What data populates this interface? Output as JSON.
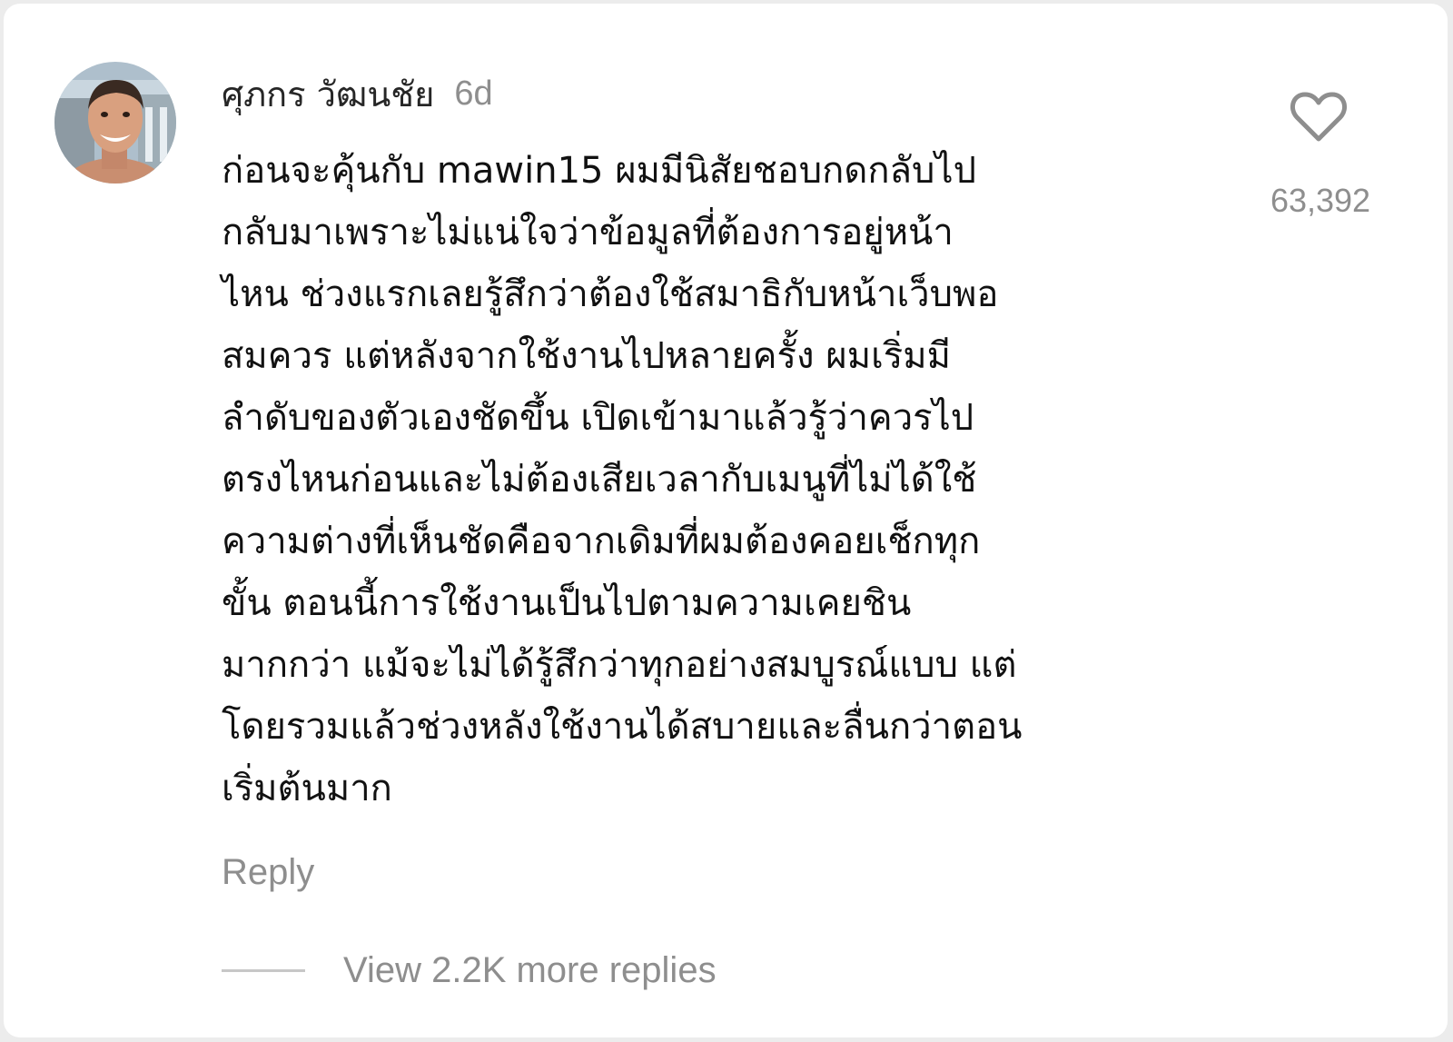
{
  "comment": {
    "author": "ศุภกร วัฒนชัย",
    "timestamp": "6d",
    "lines": [
      "ก่อนจะคุ้นกับ mawin15 ผมมีนิสัยชอบกดกลับไป",
      "กลับมาเพราะไม่แน่ใจว่าข้อมูลที่ต้องการอยู่หน้า",
      "ไหน ช่วงแรกเลยรู้สึกว่าต้องใช้สมาธิกับหน้าเว็บพอ",
      "สมควร แต่หลังจากใช้งานไปหลายครั้ง ผมเริ่มมี",
      "ลำดับของตัวเองชัดขึ้น เปิดเข้ามาแล้วรู้ว่าควรไป",
      "ตรงไหนก่อนและไม่ต้องเสียเวลากับเมนูที่ไม่ได้ใช้",
      "ความต่างที่เห็นชัดคือจากเดิมที่ผมต้องคอยเช็กทุก",
      "ขั้น ตอนนี้การใช้งานเป็นไปตามความเคยชิน",
      "มากกว่า แม้จะไม่ได้รู้สึกว่าทุกอย่างสมบูรณ์แบบ แต่",
      "โดยรวมแล้วช่วงหลังใช้งานได้สบายและลื่นกว่าตอน",
      "เริ่มต้นมาก"
    ],
    "like_count": "63,392",
    "like_icon": "heart-outline-icon",
    "reply_label": "Reply",
    "view_replies_label": "View 2.2K more replies"
  },
  "colors": {
    "text_primary": "#111111",
    "text_secondary": "#8e8e8e",
    "background": "#ffffff",
    "divider": "#c7c7c7"
  }
}
